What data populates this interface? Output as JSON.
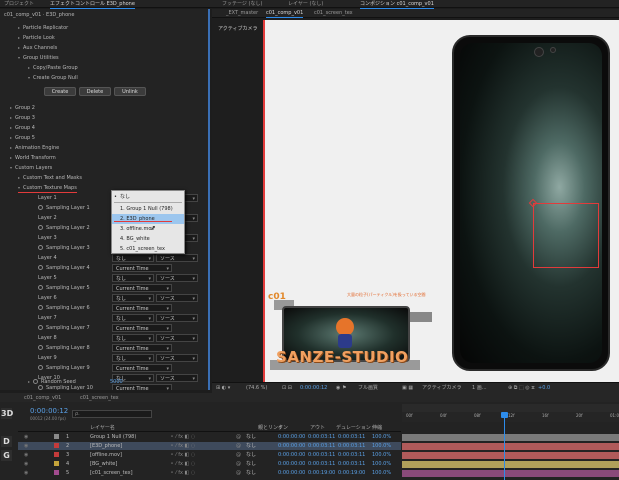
{
  "top_tabs": [
    {
      "label": "プロジェクト"
    },
    {
      "label": "エフェクトコントロール E3D_phone"
    },
    {
      "label": "フッテージ (なし)"
    },
    {
      "label": "レイヤー (なし)"
    },
    {
      "label": "コンポジション c01_comp_v01"
    }
  ],
  "effects": {
    "header": "c01_comp_v01 · E3D_phone",
    "rows": [
      "Particle Replicator",
      "Particle Look",
      "Aux Channels",
      "Group Utilities",
      "Copy/Paste Group",
      "Create Group Null"
    ],
    "buttons": {
      "create": "Create",
      "delete": "Delete",
      "unlink": "Unlink"
    },
    "groups": [
      "Group 2",
      "Group 3",
      "Group 4",
      "Group 5",
      "Animation Engine",
      "World Transform",
      "Custom Layers",
      "Custom Text and Masks",
      "Custom Texture Maps"
    ],
    "layers": [
      {
        "layer": "Layer 1",
        "sampling": "Sampling Layer 1"
      },
      {
        "layer": "Layer 2",
        "sampling": "Sampling Layer 2"
      },
      {
        "layer": "Layer 3",
        "sampling": "Sampling Layer 3"
      },
      {
        "layer": "Layer 4",
        "sampling": "Sampling Layer 4"
      },
      {
        "layer": "Layer 5",
        "sampling": "Sampling Layer 5"
      },
      {
        "layer": "Layer 6",
        "sampling": "Sampling Layer 6"
      },
      {
        "layer": "Layer 7",
        "sampling": "Sampling Layer 7"
      },
      {
        "layer": "Layer 8",
        "sampling": "Sampling Layer 8"
      },
      {
        "layer": "Layer 9",
        "sampling": "Sampling Layer 9"
      },
      {
        "layer": "Layer 10",
        "sampling": "Sampling Layer 10"
      }
    ],
    "select_none": "なし",
    "select_source": "ソース",
    "current_time": "Current Time",
    "random_seed_label": "Random Seed",
    "random_seed_value": "5000"
  },
  "dropdown": {
    "items": [
      "なし",
      "1. Group 1 Null (798)",
      "2. E3D_phone",
      "3. offline.mov",
      "4. BG_white",
      "5. c01_screen_tex"
    ],
    "highlighted_index": 2
  },
  "comp": {
    "subtabs": [
      "_EXT_master",
      "c01_comp_v01",
      "c01_screen_tex"
    ],
    "camera_label": "アクティブカメラ",
    "c01_label": "c01",
    "jp_caption": "大量の粒子(パーティクル)を扱っている空間",
    "studio_text": "SANZE-STUDIO",
    "viewer_bar": {
      "zoom": "(74.6 %)",
      "timecode": "0:00:00:12",
      "quality": "フル画質",
      "camera": "アクティブカメラ",
      "view": "1 画...",
      "offset": "+0.0"
    }
  },
  "timeline": {
    "tabs": [
      "c01_comp_v01",
      "c01_screen_tex"
    ],
    "timecode": "0:00:00:12",
    "fps": "00012 (24.00 fps)",
    "columns": {
      "name": "レイヤー名",
      "parent": "親とリンク",
      "in": "イン",
      "out": "アウト",
      "duration": "デュレーション",
      "stretch": "伸縮"
    },
    "ruler": [
      "00f",
      "04f",
      "08f",
      "12f",
      "16f",
      "20f",
      "01:00f"
    ],
    "layers": [
      {
        "num": "1",
        "name": "Group 1 Null (798)",
        "parent": "なし",
        "in": "0:00:00:00",
        "out": "0:00:03:11",
        "duration": "0:00:03:11",
        "stretch": "100.0%"
      },
      {
        "num": "2",
        "name": "[E3D_phone]",
        "parent": "なし",
        "in": "0:00:00:00",
        "out": "0:00:03:11",
        "duration": "0:00:03:11",
        "stretch": "100.0%"
      },
      {
        "num": "3",
        "name": "[offline.mov]",
        "parent": "なし",
        "in": "0:00:00:00",
        "out": "0:00:03:11",
        "duration": "0:00:03:11",
        "stretch": "100.0%"
      },
      {
        "num": "4",
        "name": "[BG_white]",
        "parent": "なし",
        "in": "0:00:00:00",
        "out": "0:00:03:11",
        "duration": "0:00:03:11",
        "stretch": "100.0%"
      },
      {
        "num": "5",
        "name": "[c01_screen_tex]",
        "parent": "なし",
        "in": "0:00:00:00",
        "out": "0:00:19:00",
        "duration": "0:00:19:00",
        "stretch": "100.0%"
      }
    ]
  },
  "sidebar_letters": [
    "3D",
    "D",
    "G"
  ]
}
